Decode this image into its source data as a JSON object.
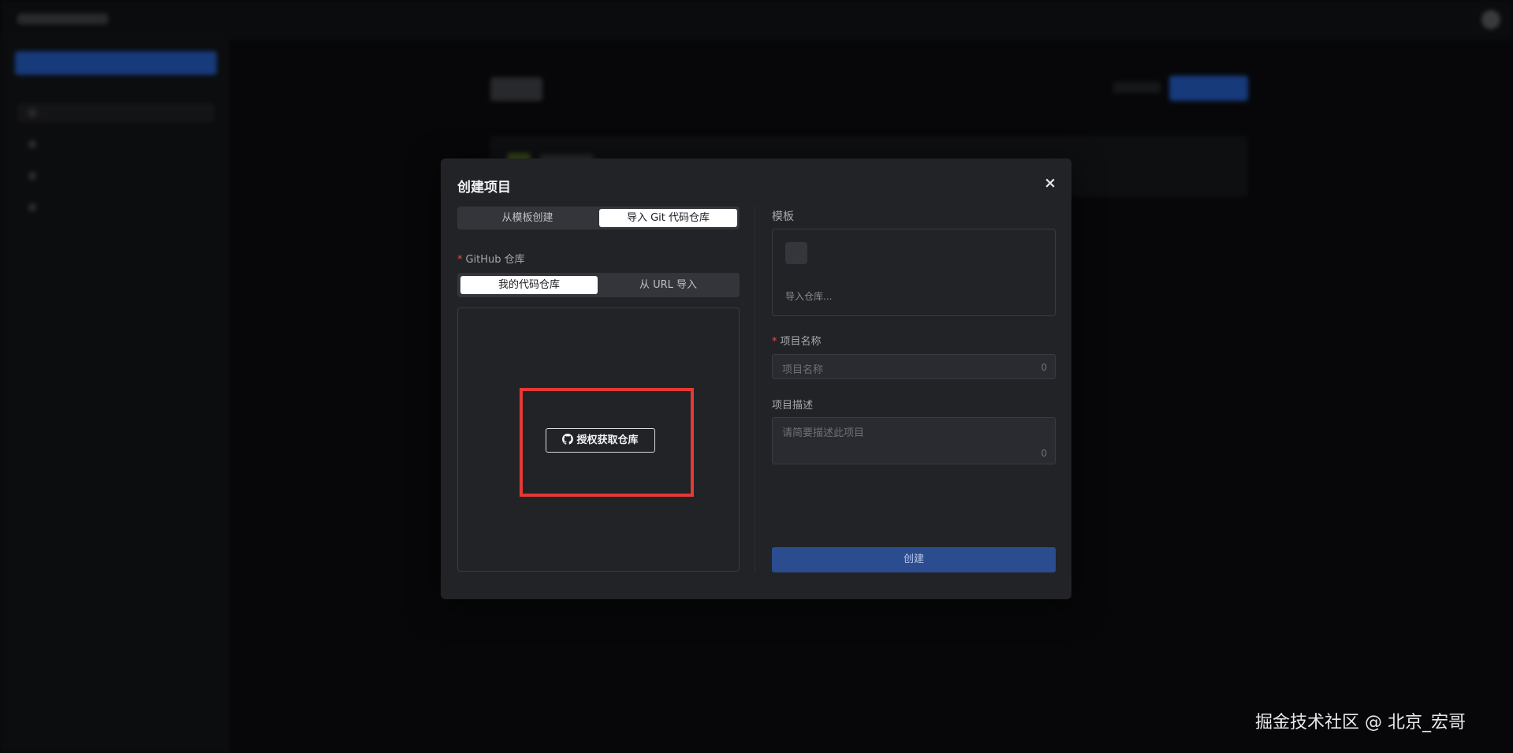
{
  "modal": {
    "title": "创建项目",
    "close_label": "×",
    "source_tabs": [
      {
        "label": "从模板创建",
        "active": false
      },
      {
        "label": "导入 Git 代码仓库",
        "active": true
      }
    ],
    "github_label": "GitHub 仓库",
    "repo_tabs": [
      {
        "label": "我的代码仓库",
        "active": true
      },
      {
        "label": "从 URL 导入",
        "active": false
      }
    ],
    "authorize_button": "授权获取仓库",
    "authorize_icon": "github-icon",
    "template_label": "模板",
    "template_placeholder": "导入仓库...",
    "project_name_label": "项目名称",
    "project_name_placeholder": "项目名称",
    "project_name_count": "0",
    "project_desc_label": "项目描述",
    "project_desc_placeholder": "请简要描述此项目",
    "project_desc_count": "0",
    "create_button": "创建"
  },
  "highlight_color": "#e53935",
  "watermark": "掘金技术社区 @ 北京_宏哥"
}
